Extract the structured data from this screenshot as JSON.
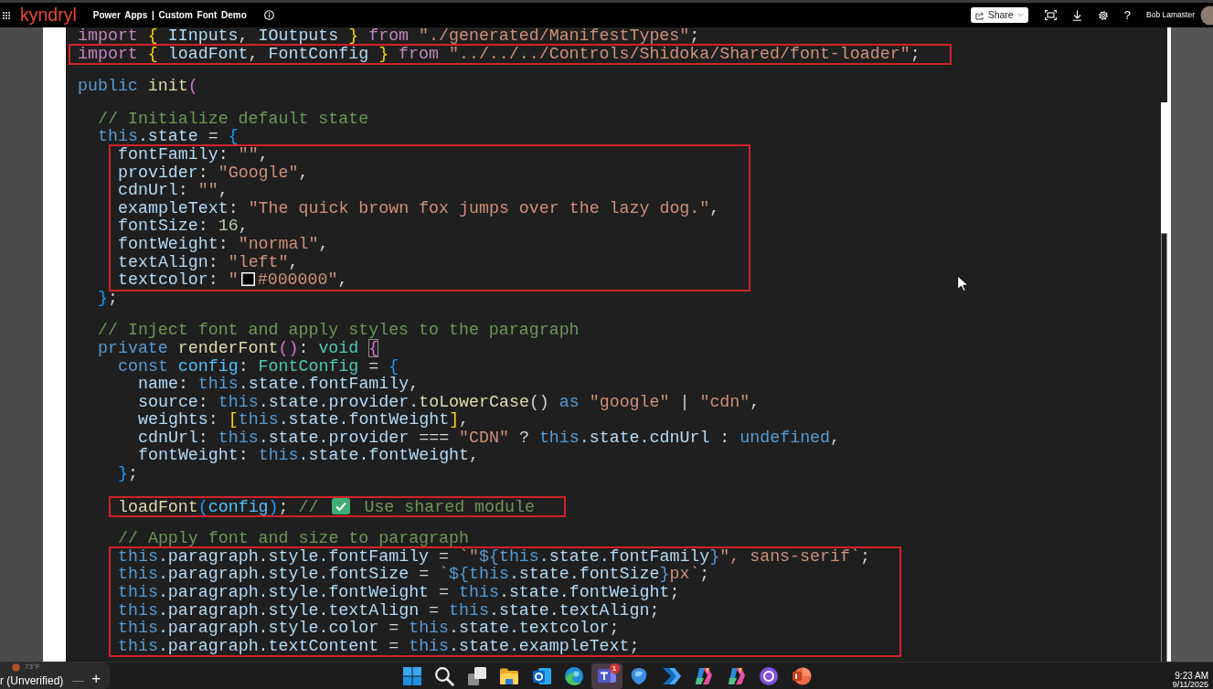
{
  "top_bar": {
    "logo": "kyndryl",
    "app_title": "Power Apps | Custom Font Demo",
    "share_label": "Share",
    "help_label": "?",
    "user_name": "Bob Lamaster"
  },
  "editor": {
    "lines": [
      {
        "kind": "line",
        "tokens": [
          {
            "kind": "ctl",
            "text": "import "
          },
          {
            "kind": "b1",
            "text": "{ "
          },
          {
            "kind": "var",
            "text": "IInputs"
          },
          {
            "kind": "p",
            "text": ", "
          },
          {
            "kind": "var",
            "text": "IOutputs "
          },
          {
            "kind": "b1",
            "text": "} "
          },
          {
            "kind": "ctl",
            "text": "from "
          },
          {
            "kind": "str",
            "text": "\"./generated/ManifestTypes\""
          },
          {
            "kind": "p",
            "text": ";"
          }
        ]
      },
      {
        "kind": "highlight",
        "children": [
          {
            "kind": "line",
            "tokens": [
              {
                "kind": "ctl",
                "text": "import "
              },
              {
                "kind": "b1",
                "text": "{ "
              },
              {
                "kind": "var",
                "text": "loadFont"
              },
              {
                "kind": "p",
                "text": ", "
              },
              {
                "kind": "var",
                "text": "FontConfig "
              },
              {
                "kind": "b1",
                "text": "} "
              },
              {
                "kind": "ctl",
                "text": "from "
              },
              {
                "kind": "str",
                "text": "\"../../../Controls/Shidoka/Shared/font-loader\""
              },
              {
                "kind": "p",
                "text": ";"
              }
            ]
          }
        ]
      },
      {
        "kind": "blank"
      },
      {
        "kind": "line",
        "tokens": [
          {
            "kind": "kw",
            "text": "public "
          },
          {
            "kind": "fn",
            "text": "init"
          },
          {
            "kind": "b2",
            "text": "("
          }
        ],
        "children": [
          {
            "kind": "blank"
          },
          {
            "kind": "line",
            "tokens": [
              {
                "kind": "com",
                "text": "// Initialize default state"
              }
            ]
          },
          {
            "kind": "line",
            "tokens": [
              {
                "kind": "kw",
                "text": "this"
              },
              {
                "kind": "var",
                "text": ".state"
              },
              {
                "kind": "p",
                "text": " = "
              },
              {
                "kind": "b3",
                "text": "{"
              }
            ],
            "children": [
              {
                "kind": "highlight",
                "children": [
                  {
                    "kind": "line",
                    "tokens": [
                      {
                        "kind": "var",
                        "text": "fontFamily"
                      },
                      {
                        "kind": "p",
                        "text": ": "
                      },
                      {
                        "kind": "str",
                        "text": "\"\""
                      },
                      {
                        "kind": "p",
                        "text": ","
                      }
                    ]
                  },
                  {
                    "kind": "line",
                    "tokens": [
                      {
                        "kind": "var",
                        "text": "provider"
                      },
                      {
                        "kind": "p",
                        "text": ": "
                      },
                      {
                        "kind": "str",
                        "text": "\"Google\""
                      },
                      {
                        "kind": "p",
                        "text": ","
                      }
                    ]
                  },
                  {
                    "kind": "line",
                    "tokens": [
                      {
                        "kind": "var",
                        "text": "cdnUrl"
                      },
                      {
                        "kind": "p",
                        "text": ": "
                      },
                      {
                        "kind": "str",
                        "text": "\"\""
                      },
                      {
                        "kind": "p",
                        "text": ","
                      }
                    ]
                  },
                  {
                    "kind": "line",
                    "tokens": [
                      {
                        "kind": "var",
                        "text": "exampleText"
                      },
                      {
                        "kind": "p",
                        "text": ": "
                      },
                      {
                        "kind": "str",
                        "text": "\"The quick brown fox jumps over the lazy dog.\""
                      },
                      {
                        "kind": "p",
                        "text": ","
                      }
                    ]
                  },
                  {
                    "kind": "line",
                    "tokens": [
                      {
                        "kind": "var",
                        "text": "fontSize"
                      },
                      {
                        "kind": "p",
                        "text": ": "
                      },
                      {
                        "kind": "num",
                        "text": "16"
                      },
                      {
                        "kind": "p",
                        "text": ","
                      }
                    ]
                  },
                  {
                    "kind": "line",
                    "tokens": [
                      {
                        "kind": "var",
                        "text": "fontWeight"
                      },
                      {
                        "kind": "p",
                        "text": ": "
                      },
                      {
                        "kind": "str",
                        "text": "\"normal\""
                      },
                      {
                        "kind": "p",
                        "text": ","
                      }
                    ]
                  },
                  {
                    "kind": "line",
                    "tokens": [
                      {
                        "kind": "var",
                        "text": "textAlign"
                      },
                      {
                        "kind": "p",
                        "text": ": "
                      },
                      {
                        "kind": "str",
                        "text": "\"left\""
                      },
                      {
                        "kind": "p",
                        "text": ","
                      }
                    ]
                  },
                  {
                    "kind": "line",
                    "tokens": [
                      {
                        "kind": "var",
                        "text": "textcolor"
                      },
                      {
                        "kind": "p",
                        "text": ": "
                      },
                      {
                        "kind": "str",
                        "text": "\""
                      },
                      {
                        "kind": "swatch",
                        "color": "#000000"
                      },
                      {
                        "kind": "str",
                        "text": "#000000\""
                      },
                      {
                        "kind": "p",
                        "text": ","
                      }
                    ]
                  }
                ]
              }
            ]
          },
          {
            "kind": "line",
            "tokens": [
              {
                "kind": "b3",
                "text": "}"
              },
              {
                "kind": "p",
                "text": ";"
              }
            ]
          },
          {
            "kind": "blank"
          },
          {
            "kind": "line",
            "tokens": [
              {
                "kind": "com",
                "text": "// Inject font and apply styles to the paragraph"
              }
            ]
          },
          {
            "kind": "line",
            "tokens": [
              {
                "kind": "kw",
                "text": "private "
              },
              {
                "kind": "fn",
                "text": "renderFont"
              },
              {
                "kind": "b2",
                "text": "()"
              },
              {
                "kind": "p",
                "text": ": "
              },
              {
                "kind": "type",
                "text": "void "
              },
              {
                "kind": "match",
                "text": "{"
              }
            ],
            "children": [
              {
                "kind": "line",
                "tokens": [
                  {
                    "kind": "kw",
                    "text": "const "
                  },
                  {
                    "kind": "const",
                    "text": "config"
                  },
                  {
                    "kind": "p",
                    "text": ": "
                  },
                  {
                    "kind": "type",
                    "text": "FontConfig"
                  },
                  {
                    "kind": "p",
                    "text": " = "
                  },
                  {
                    "kind": "b3",
                    "text": "{"
                  }
                ],
                "children": [
                  {
                    "kind": "line",
                    "tokens": [
                      {
                        "kind": "var",
                        "text": "name"
                      },
                      {
                        "kind": "p",
                        "text": ": "
                      },
                      {
                        "kind": "kw",
                        "text": "this"
                      },
                      {
                        "kind": "var",
                        "text": ".state.fontFamily"
                      },
                      {
                        "kind": "p",
                        "text": ","
                      }
                    ]
                  },
                  {
                    "kind": "line",
                    "tokens": [
                      {
                        "kind": "var",
                        "text": "source"
                      },
                      {
                        "kind": "p",
                        "text": ": "
                      },
                      {
                        "kind": "kw",
                        "text": "this"
                      },
                      {
                        "kind": "var",
                        "text": ".state.provider."
                      },
                      {
                        "kind": "fn",
                        "text": "toLowerCase"
                      },
                      {
                        "kind": "p",
                        "text": "() "
                      },
                      {
                        "kind": "kw",
                        "text": "as "
                      },
                      {
                        "kind": "str",
                        "text": "\"google\""
                      },
                      {
                        "kind": "p",
                        "text": " | "
                      },
                      {
                        "kind": "str",
                        "text": "\"cdn\""
                      },
                      {
                        "kind": "p",
                        "text": ","
                      }
                    ]
                  },
                  {
                    "kind": "line",
                    "tokens": [
                      {
                        "kind": "var",
                        "text": "weights"
                      },
                      {
                        "kind": "p",
                        "text": ": "
                      },
                      {
                        "kind": "b1",
                        "text": "["
                      },
                      {
                        "kind": "kw",
                        "text": "this"
                      },
                      {
                        "kind": "var",
                        "text": ".state.fontWeight"
                      },
                      {
                        "kind": "b1",
                        "text": "]"
                      },
                      {
                        "kind": "p",
                        "text": ","
                      }
                    ]
                  },
                  {
                    "kind": "line",
                    "tokens": [
                      {
                        "kind": "var",
                        "text": "cdnUrl"
                      },
                      {
                        "kind": "p",
                        "text": ": "
                      },
                      {
                        "kind": "kw",
                        "text": "this"
                      },
                      {
                        "kind": "var",
                        "text": ".state.provider"
                      },
                      {
                        "kind": "p",
                        "text": " === "
                      },
                      {
                        "kind": "str",
                        "text": "\"CDN\""
                      },
                      {
                        "kind": "p",
                        "text": " ? "
                      },
                      {
                        "kind": "kw",
                        "text": "this"
                      },
                      {
                        "kind": "var",
                        "text": ".state.cdnUrl"
                      },
                      {
                        "kind": "p",
                        "text": " : "
                      },
                      {
                        "kind": "kw",
                        "text": "undefined"
                      },
                      {
                        "kind": "p",
                        "text": ","
                      }
                    ]
                  },
                  {
                    "kind": "line",
                    "tokens": [
                      {
                        "kind": "var",
                        "text": "fontWeight"
                      },
                      {
                        "kind": "p",
                        "text": ": "
                      },
                      {
                        "kind": "kw",
                        "text": "this"
                      },
                      {
                        "kind": "var",
                        "text": ".state.fontWeight"
                      },
                      {
                        "kind": "p",
                        "text": ","
                      }
                    ]
                  }
                ]
              },
              {
                "kind": "line",
                "tokens": [
                  {
                    "kind": "b3",
                    "text": "}"
                  },
                  {
                    "kind": "p",
                    "text": ";"
                  }
                ]
              },
              {
                "kind": "blank"
              },
              {
                "kind": "highlight",
                "children": [
                  {
                    "kind": "line",
                    "tokens": [
                      {
                        "kind": "fn",
                        "text": "loadFont"
                      },
                      {
                        "kind": "b3",
                        "text": "("
                      },
                      {
                        "kind": "const",
                        "text": "config"
                      },
                      {
                        "kind": "b3",
                        "text": ")"
                      },
                      {
                        "kind": "p",
                        "text": "; "
                      },
                      {
                        "kind": "com",
                        "text": "// "
                      },
                      {
                        "kind": "check"
                      },
                      {
                        "kind": "com",
                        "text": " Use shared module"
                      }
                    ]
                  }
                ]
              },
              {
                "kind": "blank"
              },
              {
                "kind": "line",
                "tokens": [
                  {
                    "kind": "com",
                    "text": "// Apply font and size to paragraph"
                  }
                ]
              },
              {
                "kind": "highlight",
                "children": [
                  {
                    "kind": "line",
                    "tokens": [
                      {
                        "kind": "kw",
                        "text": "this"
                      },
                      {
                        "kind": "var",
                        "text": ".paragraph.style.fontFamily"
                      },
                      {
                        "kind": "p",
                        "text": " = "
                      },
                      {
                        "kind": "str",
                        "text": "`\""
                      },
                      {
                        "kind": "kw",
                        "text": "${this"
                      },
                      {
                        "kind": "var",
                        "text": ".state.fontFamily"
                      },
                      {
                        "kind": "kw",
                        "text": "}"
                      },
                      {
                        "kind": "str",
                        "text": "\", sans-serif`"
                      },
                      {
                        "kind": "p",
                        "text": ";"
                      }
                    ]
                  },
                  {
                    "kind": "line",
                    "tokens": [
                      {
                        "kind": "kw",
                        "text": "this"
                      },
                      {
                        "kind": "var",
                        "text": ".paragraph.style.fontSize"
                      },
                      {
                        "kind": "p",
                        "text": " = "
                      },
                      {
                        "kind": "str",
                        "text": "`"
                      },
                      {
                        "kind": "kw",
                        "text": "${this"
                      },
                      {
                        "kind": "var",
                        "text": ".state.fontSize"
                      },
                      {
                        "kind": "kw",
                        "text": "}"
                      },
                      {
                        "kind": "str",
                        "text": "px`"
                      },
                      {
                        "kind": "p",
                        "text": ";"
                      }
                    ]
                  },
                  {
                    "kind": "line",
                    "tokens": [
                      {
                        "kind": "kw",
                        "text": "this"
                      },
                      {
                        "kind": "var",
                        "text": ".paragraph.style.fontWeight"
                      },
                      {
                        "kind": "p",
                        "text": " = "
                      },
                      {
                        "kind": "kw",
                        "text": "this"
                      },
                      {
                        "kind": "var",
                        "text": ".state.fontWeight"
                      },
                      {
                        "kind": "p",
                        "text": ";"
                      }
                    ]
                  },
                  {
                    "kind": "line",
                    "tokens": [
                      {
                        "kind": "kw",
                        "text": "this"
                      },
                      {
                        "kind": "var",
                        "text": ".paragraph.style.textAlign"
                      },
                      {
                        "kind": "p",
                        "text": " = "
                      },
                      {
                        "kind": "kw",
                        "text": "this"
                      },
                      {
                        "kind": "var",
                        "text": ".state.textAlign"
                      },
                      {
                        "kind": "p",
                        "text": ";"
                      }
                    ]
                  },
                  {
                    "kind": "line",
                    "tokens": [
                      {
                        "kind": "kw",
                        "text": "this"
                      },
                      {
                        "kind": "var",
                        "text": ".paragraph.style.color"
                      },
                      {
                        "kind": "p",
                        "text": " = "
                      },
                      {
                        "kind": "kw",
                        "text": "this"
                      },
                      {
                        "kind": "var",
                        "text": ".state.textcolor"
                      },
                      {
                        "kind": "p",
                        "text": ";"
                      }
                    ]
                  },
                  {
                    "kind": "line",
                    "tokens": [
                      {
                        "kind": "kw",
                        "text": "this"
                      },
                      {
                        "kind": "var",
                        "text": ".paragraph.textContent"
                      },
                      {
                        "kind": "p",
                        "text": " = "
                      },
                      {
                        "kind": "kw",
                        "text": "this"
                      },
                      {
                        "kind": "var",
                        "text": ".state.exampleText"
                      },
                      {
                        "kind": "p",
                        "text": ";"
                      }
                    ]
                  }
                ]
              }
            ]
          }
        ]
      }
    ]
  },
  "taskbar": {
    "weather": "73°F",
    "window_title": "r (Unverified)",
    "minimize_label": "—",
    "add_label": "+",
    "apps": [
      {
        "kind": "start",
        "active": false
      },
      {
        "kind": "search",
        "active": false
      },
      {
        "kind": "taskview",
        "active": false
      },
      {
        "kind": "folder",
        "active": false
      },
      {
        "kind": "mail",
        "active": false
      },
      {
        "kind": "browser",
        "active": false
      },
      {
        "kind": "chat",
        "active": true,
        "badge": "1"
      },
      {
        "kind": "blob",
        "active": false
      },
      {
        "kind": "chevrons",
        "active": false
      },
      {
        "kind": "assistant",
        "active": false
      },
      {
        "kind": "assistant",
        "active": false
      },
      {
        "kind": "ring",
        "active": false
      },
      {
        "kind": "slides",
        "active": false
      }
    ],
    "time": "9:23 AM",
    "date": "9/11/2025"
  }
}
